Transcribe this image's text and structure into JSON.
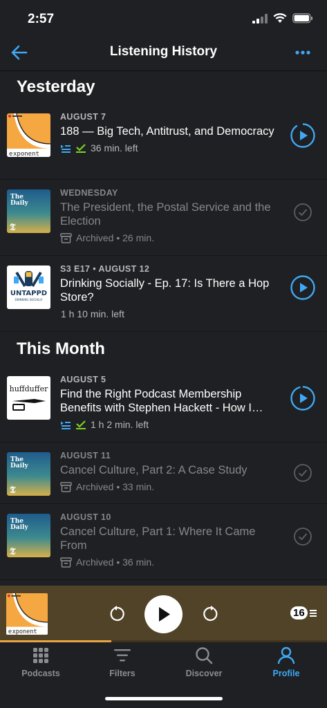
{
  "status_bar": {
    "time": "2:57"
  },
  "nav": {
    "title": "Listening History"
  },
  "sections": [
    {
      "title": "Yesterday",
      "episodes": [
        {
          "date": "AUGUST 7",
          "title": "188 — Big Tech, Antitrust, and Democracy",
          "meta": "36 min. left"
        },
        {
          "date": "WEDNESDAY",
          "title": "The President, the Postal Service and the Election",
          "meta": "Archived • 26 min."
        },
        {
          "date": "S3 E17 • AUGUST 12",
          "title": "Drinking Socially - Ep. 17: Is There a Hop Store?",
          "meta": "1 h 10 min. left"
        }
      ]
    },
    {
      "title": "This Month",
      "episodes": [
        {
          "date": "AUGUST 5",
          "title": "Find the Right Podcast Membership Benefits with Stephen Hackett - How I…",
          "meta": "1 h 2 min. left"
        },
        {
          "date": "AUGUST 11",
          "title": "Cancel Culture, Part 2: A Case Study",
          "meta": "Archived • 33 min."
        },
        {
          "date": "AUGUST 10",
          "title": "Cancel Culture, Part 1: Where It Came From",
          "meta": "Archived • 36 min."
        }
      ]
    }
  ],
  "artwork": {
    "exponent": "xponent",
    "daily_line1": "The",
    "daily_line2": "Daily",
    "untappd": "UNTAPPD",
    "untappd_sub": "DRINKING SOCIALLY",
    "huffduffer": "huffduffer"
  },
  "mini_player": {
    "queue_count": "16",
    "progress": 0.34
  },
  "tabs": {
    "podcasts": "Podcasts",
    "filters": "Filters",
    "discover": "Discover",
    "profile": "Profile"
  },
  "colors": {
    "accent": "#3fa9f5",
    "played_green": "#7ed321",
    "player_bg": "#514327",
    "progress": "#e9a545"
  }
}
